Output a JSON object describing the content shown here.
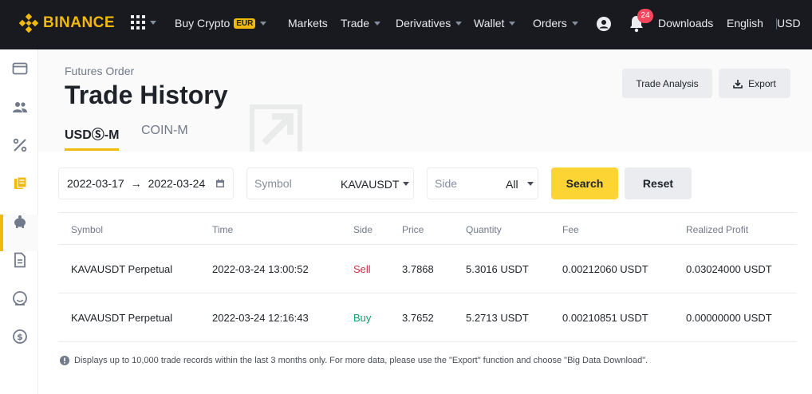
{
  "brand": {
    "name": "BINANCE",
    "color": "#f0b90b"
  },
  "nav": {
    "buy_crypto": "Buy Crypto",
    "currency_badge": "EUR",
    "markets": "Markets",
    "trade": "Trade",
    "derivatives": "Derivatives",
    "wallet": "Wallet",
    "orders": "Orders",
    "notification_count": "24",
    "downloads": "Downloads",
    "language": "English",
    "currency": "USD"
  },
  "header": {
    "breadcrumb": "Futures Order",
    "title": "Trade History",
    "tabs": [
      {
        "label": "USDⓈ-M",
        "active": true
      },
      {
        "label": "COIN-M",
        "active": false
      }
    ],
    "trade_analysis_label": "Trade Analysis",
    "export_label": "Export"
  },
  "filters": {
    "date_start": "2022-03-17",
    "date_arrow": "→",
    "date_end": "2022-03-24",
    "symbol_label": "Symbol",
    "symbol_value": "KAVAUSDT",
    "side_label": "Side",
    "side_value": "All",
    "search_label": "Search",
    "reset_label": "Reset"
  },
  "table": {
    "headers": [
      "Symbol",
      "Time",
      "Side",
      "Price",
      "Quantity",
      "Fee",
      "Realized Profit"
    ],
    "rows": [
      {
        "symbol": "KAVAUSDT Perpetual",
        "time": "2022-03-24 13:00:52",
        "side": "Sell",
        "price": "3.7868",
        "quantity": "5.3016 USDT",
        "fee": "0.00212060 USDT",
        "profit": "0.03024000 USDT"
      },
      {
        "symbol": "KAVAUSDT Perpetual",
        "time": "2022-03-24 12:16:43",
        "side": "Buy",
        "price": "3.7652",
        "quantity": "5.2713 USDT",
        "fee": "0.00210851 USDT",
        "profit": "0.00000000 USDT"
      }
    ]
  },
  "note": "Displays up to 10,000 trade records within the last 3 months only. For more data, please use the \"Export\" function and choose \"Big Data Download\".",
  "colors": {
    "sell": "#cf304a",
    "buy": "#03a66d",
    "accent": "#f0b90b",
    "search_button": "#fcd535"
  },
  "icons": {
    "sidebar": [
      "wallet-icon",
      "users-icon",
      "percent-icon",
      "orders-icon",
      "piggy-bank-icon",
      "document-icon",
      "face-icon",
      "dollar-coin-icon"
    ]
  }
}
